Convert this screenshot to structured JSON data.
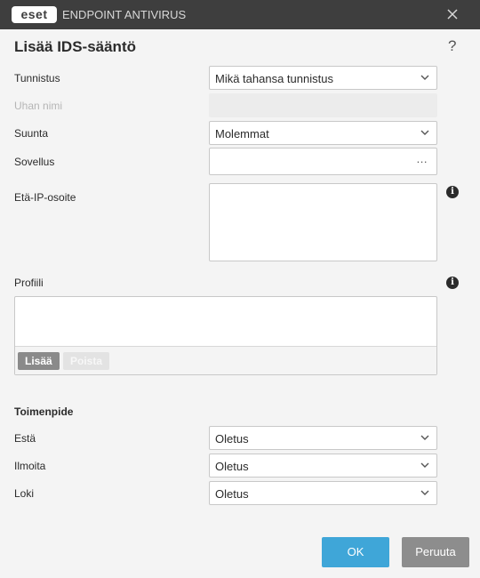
{
  "window": {
    "brand": "eset",
    "product": "ENDPOINT ANTIVIRUS"
  },
  "dialog": {
    "title": "Lisää IDS-sääntö",
    "help": "?"
  },
  "form": {
    "detection": {
      "label": "Tunnistus",
      "value": "Mikä tahansa tunnistus"
    },
    "threat_name": {
      "label": "Uhan nimi",
      "value": ""
    },
    "direction": {
      "label": "Suunta",
      "value": "Molemmat"
    },
    "application": {
      "label": "Sovellus",
      "value": "",
      "browse": "..."
    },
    "remote_ip": {
      "label": "Etä-IP-osoite",
      "value": ""
    },
    "profiles": {
      "label": "Profiili",
      "items": [],
      "add_label": "Lisää",
      "remove_label": "Poista"
    }
  },
  "action": {
    "section_title": "Toimenpide",
    "block": {
      "label": "Estä",
      "value": "Oletus"
    },
    "notify": {
      "label": "Ilmoita",
      "value": "Oletus"
    },
    "log": {
      "label": "Loki",
      "value": "Oletus"
    }
  },
  "buttons": {
    "ok": "OK",
    "cancel": "Peruuta"
  },
  "colors": {
    "titlebar": "#3e3e3e",
    "primary": "#3fa6d8",
    "secondary": "#8d8d8d"
  }
}
